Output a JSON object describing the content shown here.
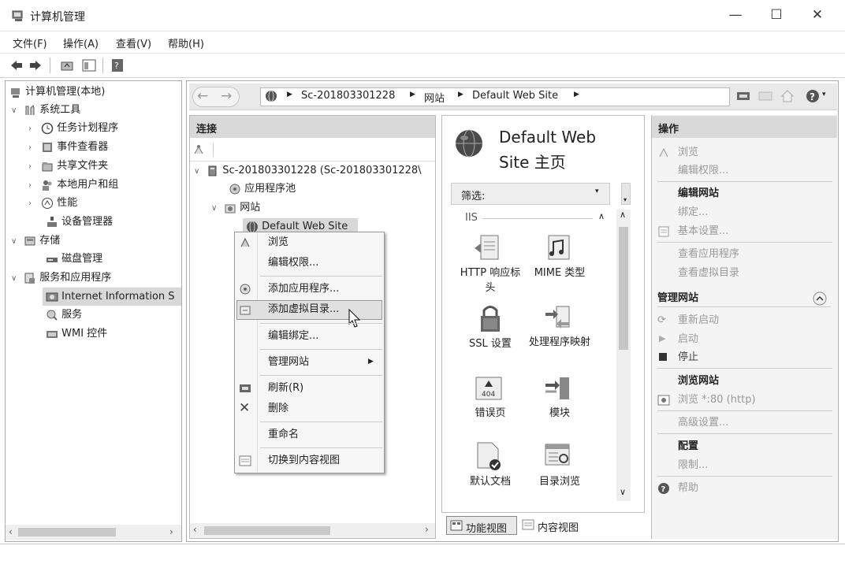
{
  "window": {
    "title": "计算机管理",
    "minimize": "—",
    "maximize": "☐",
    "close": "✕"
  },
  "menubar": [
    "文件(F)",
    "操作(A)",
    "查看(V)",
    "帮助(H)"
  ],
  "tree": {
    "root": "计算机管理(本地)",
    "system_tools": "系统工具",
    "task_scheduler": "任务计划程序",
    "event_viewer": "事件查看器",
    "shared_folders": "共享文件夹",
    "local_users": "本地用户和组",
    "performance": "性能",
    "device_manager": "设备管理器",
    "storage": "存储",
    "disk_management": "磁盘管理",
    "services_apps": "服务和应用程序",
    "iis": "Internet Information S",
    "services": "服务",
    "wmi": "WMI 控件"
  },
  "address": {
    "server": "Sc-201803301228",
    "sites": "网站",
    "site": "Default Web Site"
  },
  "connections": {
    "header": "连接",
    "server_node": "Sc-201803301228 (Sc-201803301228\\",
    "app_pools": "应用程序池",
    "sites": "网站",
    "default_site": "Default Web Site"
  },
  "center": {
    "title_line1": "Default Web",
    "title_line2": "Site 主页",
    "filter_label": "筛选:",
    "group": "IIS",
    "features": [
      {
        "label": "HTTP 响应标头",
        "icon": "http-headers-icon"
      },
      {
        "label": "MIME 类型",
        "icon": "mime-types-icon"
      },
      {
        "label": "SSL 设置",
        "icon": "ssl-lock-icon"
      },
      {
        "label": "处理程序映射",
        "icon": "handler-mappings-icon"
      },
      {
        "label": "错误页",
        "icon": "error-pages-icon"
      },
      {
        "label": "模块",
        "icon": "modules-icon"
      },
      {
        "label": "默认文档",
        "icon": "default-document-icon"
      },
      {
        "label": "目录浏览",
        "icon": "directory-browsing-icon"
      }
    ],
    "error_code": "404",
    "view_feature": "功能视图",
    "view_content": "内容视图"
  },
  "context_menu": {
    "browse": "浏览",
    "edit_permissions": "编辑权限...",
    "add_application": "添加应用程序...",
    "add_virtual_dir": "添加虚拟目录...",
    "edit_bindings": "编辑绑定...",
    "manage_site": "管理网站",
    "refresh": "刷新(R)",
    "delete": "删除",
    "rename": "重命名",
    "switch_content": "切换到内容视图"
  },
  "actions": {
    "header": "操作",
    "browse": "浏览",
    "edit_permissions": "编辑权限...",
    "edit_site": "编辑网站",
    "bindings": "绑定...",
    "basic_settings": "基本设置...",
    "view_apps": "查看应用程序",
    "view_vdirs": "查看虚拟目录",
    "manage_site": "管理网站",
    "restart": "重新启动",
    "start": "启动",
    "stop": "停止",
    "browse_site": "浏览网站",
    "browse_80": "浏览 *:80 (http)",
    "advanced": "高级设置...",
    "config": "配置",
    "limits": "限制...",
    "help": "帮助"
  }
}
